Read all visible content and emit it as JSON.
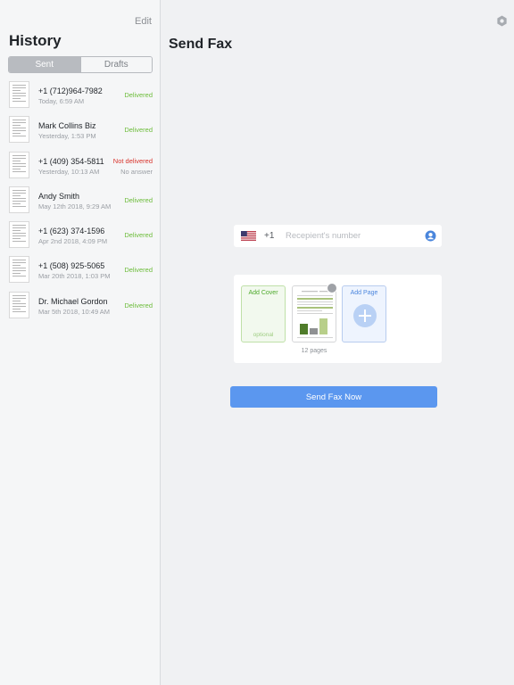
{
  "sidebar": {
    "edit_label": "Edit",
    "title": "History",
    "tabs": [
      {
        "label": "Sent",
        "active": true
      },
      {
        "label": "Drafts",
        "active": false
      }
    ],
    "items": [
      {
        "name": "+1 (712)964-7982",
        "time": "Today, 6:59 AM",
        "status": "Delivered",
        "reason": ""
      },
      {
        "name": "Mark Collins Biz",
        "time": "Yesterday, 1:53 PM",
        "status": "Delivered",
        "reason": ""
      },
      {
        "name": "+1 (409) 354-5811",
        "time": "Yesterday, 10:13 AM",
        "status": "Not delivered",
        "reason": "No answer"
      },
      {
        "name": "Andy Smith",
        "time": "May 12th 2018, 9:29 AM",
        "status": "Delivered",
        "reason": ""
      },
      {
        "name": "+1 (623) 374-1596",
        "time": "Apr 2nd 2018, 4:09 PM",
        "status": "Delivered",
        "reason": ""
      },
      {
        "name": "+1 (508) 925-5065",
        "time": "Mar 20th 2018, 1:03 PM",
        "status": "Delivered",
        "reason": ""
      },
      {
        "name": "Dr. Michael Gordon",
        "time": "Mar 5th 2018, 10:49 AM",
        "status": "Delivered",
        "reason": ""
      }
    ]
  },
  "main": {
    "title": "Send Fax",
    "settings_icon": "gear-icon",
    "recipient": {
      "flag_icon": "us-flag-icon",
      "country_code": "+1",
      "placeholder": "Recepient's number",
      "value": "",
      "contact_icon": "contact-icon"
    },
    "pages": {
      "add_cover_label": "Add Cover",
      "cover_optional_label": "optional",
      "add_page_label": "Add Page",
      "page_count": "12 pages"
    },
    "send_label": "Send Fax Now"
  },
  "colors": {
    "accent": "#5b97ef",
    "delivered": "#6cbc3a",
    "not_delivered": "#d8342c",
    "cover_green": "#4eaa2c"
  }
}
